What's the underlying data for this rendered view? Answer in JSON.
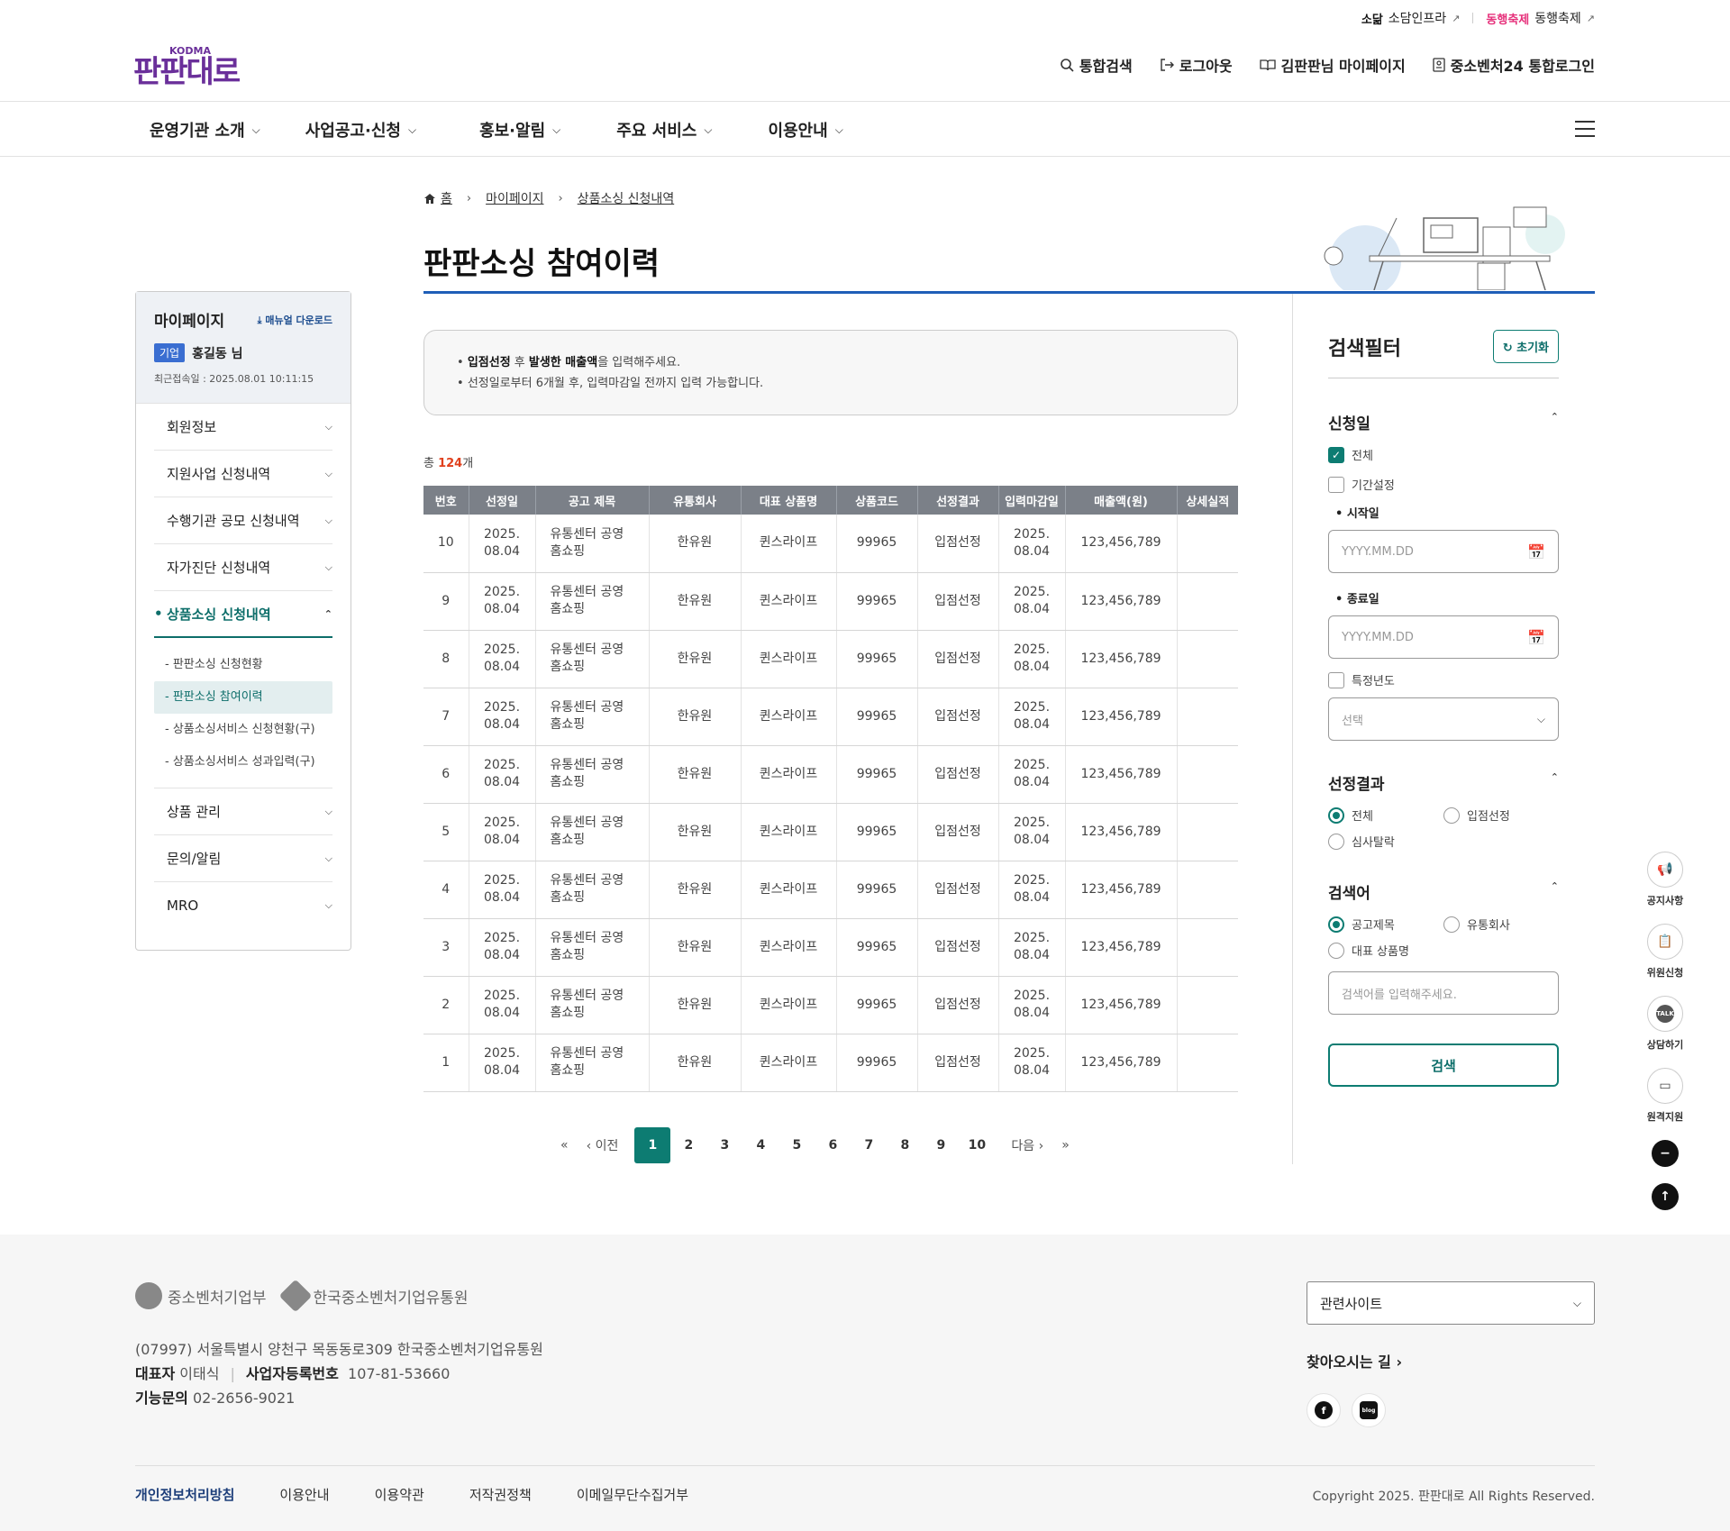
{
  "utility": {
    "sodam_logo": "소닮",
    "sodam_label": "소담인프라",
    "fest_logo": "동행축제",
    "fest_label": "동행축제",
    "ext": "↗"
  },
  "logo": {
    "kodma": "KODMA",
    "word": "판판대로"
  },
  "header_links": {
    "search": "통합검색",
    "logout": "로그아웃",
    "mypage": "김판판님 마이페이지",
    "integrated_login": "중소벤처24 통합로그인"
  },
  "main_nav": [
    {
      "label": "운영기관 소개"
    },
    {
      "label": "사업공고·신청"
    },
    {
      "label": "홍보·알림"
    },
    {
      "label": "주요 서비스"
    },
    {
      "label": "이용안내"
    }
  ],
  "breadcrumb": {
    "home": "홈",
    "level1": "마이페이지",
    "level2": "상품소싱 신청내역"
  },
  "page_title": "판판소싱 참여이력",
  "sidebar": {
    "title": "마이페이지",
    "manual": "매뉴얼 다운로드",
    "badge": "기업",
    "user": "홍길동 님",
    "last_login": "최근접속일 : 2025.08.01 10:11:15",
    "items": [
      {
        "label": "회원정보"
      },
      {
        "label": "지원사업 신청내역"
      },
      {
        "label": "수행기관 공모 신청내역"
      },
      {
        "label": "자가진단 신청내역"
      },
      {
        "label": "상품소싱 신청내역"
      },
      {
        "label": "상품 관리"
      },
      {
        "label": "문의/알림"
      },
      {
        "label": "MRO"
      }
    ],
    "subitems": [
      {
        "label": "- 판판소싱 신청현황"
      },
      {
        "label": "- 판판소싱 참여이력"
      },
      {
        "label": "- 상품소싱서비스 신청현황(구)"
      },
      {
        "label": "- 상품소싱서비스 성과입력(구)"
      }
    ]
  },
  "notice": {
    "line1_b1": "입점선정",
    "line1_t1": " 후 ",
    "line1_b2": "발생한 매출액",
    "line1_t2": "을 입력해주세요.",
    "line2": "선정일로부터 6개월 후, 입력마감일 전까지 입력 가능합니다."
  },
  "total": {
    "prefix": "총 ",
    "count": "124",
    "suffix": "개"
  },
  "table": {
    "headers": [
      "번호",
      "선정일",
      "공고 제목",
      "유통회사",
      "대표 상품명",
      "상품코드",
      "선정결과",
      "입력마감일",
      "매출액(원)",
      "상세실적"
    ],
    "rows": [
      {
        "no": "10",
        "sel_date_1": "2025.",
        "sel_date_2": "08.04",
        "title_1": "유통센터 공영",
        "title_2": "홈쇼핑",
        "company": "한유원",
        "product": "퀸스라이프",
        "code": "99965",
        "result": "입점선정",
        "due_1": "2025.",
        "due_2": "08.04",
        "sales": "123,456,789"
      },
      {
        "no": "9",
        "sel_date_1": "2025.",
        "sel_date_2": "08.04",
        "title_1": "유통센터 공영",
        "title_2": "홈쇼핑",
        "company": "한유원",
        "product": "퀸스라이프",
        "code": "99965",
        "result": "입점선정",
        "due_1": "2025.",
        "due_2": "08.04",
        "sales": "123,456,789"
      },
      {
        "no": "8",
        "sel_date_1": "2025.",
        "sel_date_2": "08.04",
        "title_1": "유통센터 공영",
        "title_2": "홈쇼핑",
        "company": "한유원",
        "product": "퀸스라이프",
        "code": "99965",
        "result": "입점선정",
        "due_1": "2025.",
        "due_2": "08.04",
        "sales": "123,456,789"
      },
      {
        "no": "7",
        "sel_date_1": "2025.",
        "sel_date_2": "08.04",
        "title_1": "유통센터 공영",
        "title_2": "홈쇼핑",
        "company": "한유원",
        "product": "퀸스라이프",
        "code": "99965",
        "result": "입점선정",
        "due_1": "2025.",
        "due_2": "08.04",
        "sales": "123,456,789"
      },
      {
        "no": "6",
        "sel_date_1": "2025.",
        "sel_date_2": "08.04",
        "title_1": "유통센터 공영",
        "title_2": "홈쇼핑",
        "company": "한유원",
        "product": "퀸스라이프",
        "code": "99965",
        "result": "입점선정",
        "due_1": "2025.",
        "due_2": "08.04",
        "sales": "123,456,789"
      },
      {
        "no": "5",
        "sel_date_1": "2025.",
        "sel_date_2": "08.04",
        "title_1": "유통센터 공영",
        "title_2": "홈쇼핑",
        "company": "한유원",
        "product": "퀸스라이프",
        "code": "99965",
        "result": "입점선정",
        "due_1": "2025.",
        "due_2": "08.04",
        "sales": "123,456,789"
      },
      {
        "no": "4",
        "sel_date_1": "2025.",
        "sel_date_2": "08.04",
        "title_1": "유통센터 공영",
        "title_2": "홈쇼핑",
        "company": "한유원",
        "product": "퀸스라이프",
        "code": "99965",
        "result": "입점선정",
        "due_1": "2025.",
        "due_2": "08.04",
        "sales": "123,456,789"
      },
      {
        "no": "3",
        "sel_date_1": "2025.",
        "sel_date_2": "08.04",
        "title_1": "유통센터 공영",
        "title_2": "홈쇼핑",
        "company": "한유원",
        "product": "퀸스라이프",
        "code": "99965",
        "result": "입점선정",
        "due_1": "2025.",
        "due_2": "08.04",
        "sales": "123,456,789"
      },
      {
        "no": "2",
        "sel_date_1": "2025.",
        "sel_date_2": "08.04",
        "title_1": "유통센터 공영",
        "title_2": "홈쇼핑",
        "company": "한유원",
        "product": "퀸스라이프",
        "code": "99965",
        "result": "입점선정",
        "due_1": "2025.",
        "due_2": "08.04",
        "sales": "123,456,789"
      },
      {
        "no": "1",
        "sel_date_1": "2025.",
        "sel_date_2": "08.04",
        "title_1": "유통센터 공영",
        "title_2": "홈쇼핑",
        "company": "한유원",
        "product": "퀸스라이프",
        "code": "99965",
        "result": "입점선정",
        "due_1": "2025.",
        "due_2": "08.04",
        "sales": "123,456,789"
      }
    ]
  },
  "pagination": {
    "first": "«",
    "prev": "‹ 이전",
    "pages": [
      "1",
      "2",
      "3",
      "4",
      "5",
      "6",
      "7",
      "8",
      "9",
      "10"
    ],
    "current": "1",
    "next": "다음 ›",
    "last": "»"
  },
  "filter": {
    "title": "검색필터",
    "reset": "초기화",
    "apply_date": {
      "title": "신청일",
      "all": "전체",
      "period": "기간설정",
      "start_label": "시작일",
      "end_label": "종료일",
      "date_placeholder": "YYYY.MM.DD",
      "year": "특정년도",
      "year_placeholder": "선택"
    },
    "result": {
      "title": "선정결과",
      "options": [
        "전체",
        "입점선정",
        "심사탈락"
      ]
    },
    "keyword": {
      "title": "검색어",
      "options": [
        "공고제목",
        "유통회사",
        "대표 상품명"
      ],
      "placeholder": "검색어를 입력해주세요."
    },
    "search": "검색"
  },
  "quick_menu": [
    {
      "label": "공지사항",
      "icon": "megaphone-icon"
    },
    {
      "label": "위원신청",
      "icon": "clipboard-icon"
    },
    {
      "label": "상담하기",
      "icon": "talk-icon"
    },
    {
      "label": "원격지원",
      "icon": "monitor-icon"
    }
  ],
  "footer": {
    "logo1": "중소벤처기업부",
    "logo2": "한국중소벤처기업유통원",
    "address": "(07997) 서울특별시 양천구 목동동로309 한국중소벤처기업유통원",
    "ceo_label": "대표자",
    "ceo": "이태식",
    "biz_label": "사업자등록번호",
    "biz": "107-81-53660",
    "tel_label": "기능문의",
    "tel": "02-2656-9021",
    "related": "관련사이트",
    "way": "찾아오시는 길 ›",
    "links": [
      "개인정보처리방침",
      "이용안내",
      "이용약관",
      "저작권정책",
      "이메일무단수집거부"
    ],
    "copyright": "Copyright 2025. 판판대로 All Rights Reserved."
  },
  "colors": {
    "accent": "#0d7c72",
    "title_line": "#1f5eb7",
    "brand": "#6a2f9a",
    "count": "#e0401d"
  }
}
